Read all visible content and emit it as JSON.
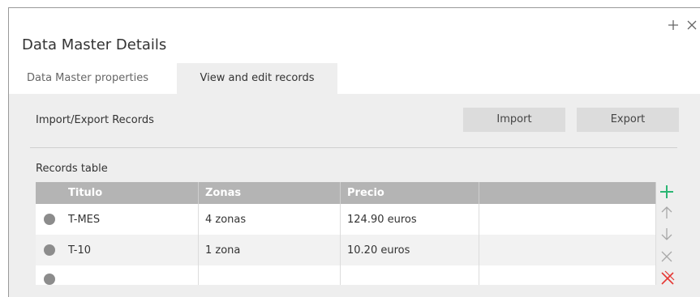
{
  "window": {
    "title": "Data Master Details",
    "controls": {
      "add_icon": "plus-icon",
      "close_icon": "close-icon"
    }
  },
  "tabs": [
    {
      "label": "Data Master properties",
      "active": false
    },
    {
      "label": "View and edit records",
      "active": true
    }
  ],
  "import_export": {
    "label": "Import/Export Records",
    "import_label": "Import",
    "export_label": "Export"
  },
  "records": {
    "label": "Records table",
    "columns": [
      "Titulo",
      "Zonas",
      "Precio",
      ""
    ],
    "rows": [
      {
        "titulo": "T-MES",
        "zonas": "4 zonas",
        "precio": "124.90 euros"
      },
      {
        "titulo": "T-10",
        "zonas": "1 zona",
        "precio": "10.20 euros"
      }
    ]
  },
  "row_actions": [
    "add-row-icon",
    "move-up-icon",
    "move-down-icon",
    "delete-row-icon",
    "delete-all-icon"
  ],
  "colors": {
    "accent_green": "#2bb673",
    "danger_red": "#e53935",
    "header_gray": "#b4b4b4"
  }
}
